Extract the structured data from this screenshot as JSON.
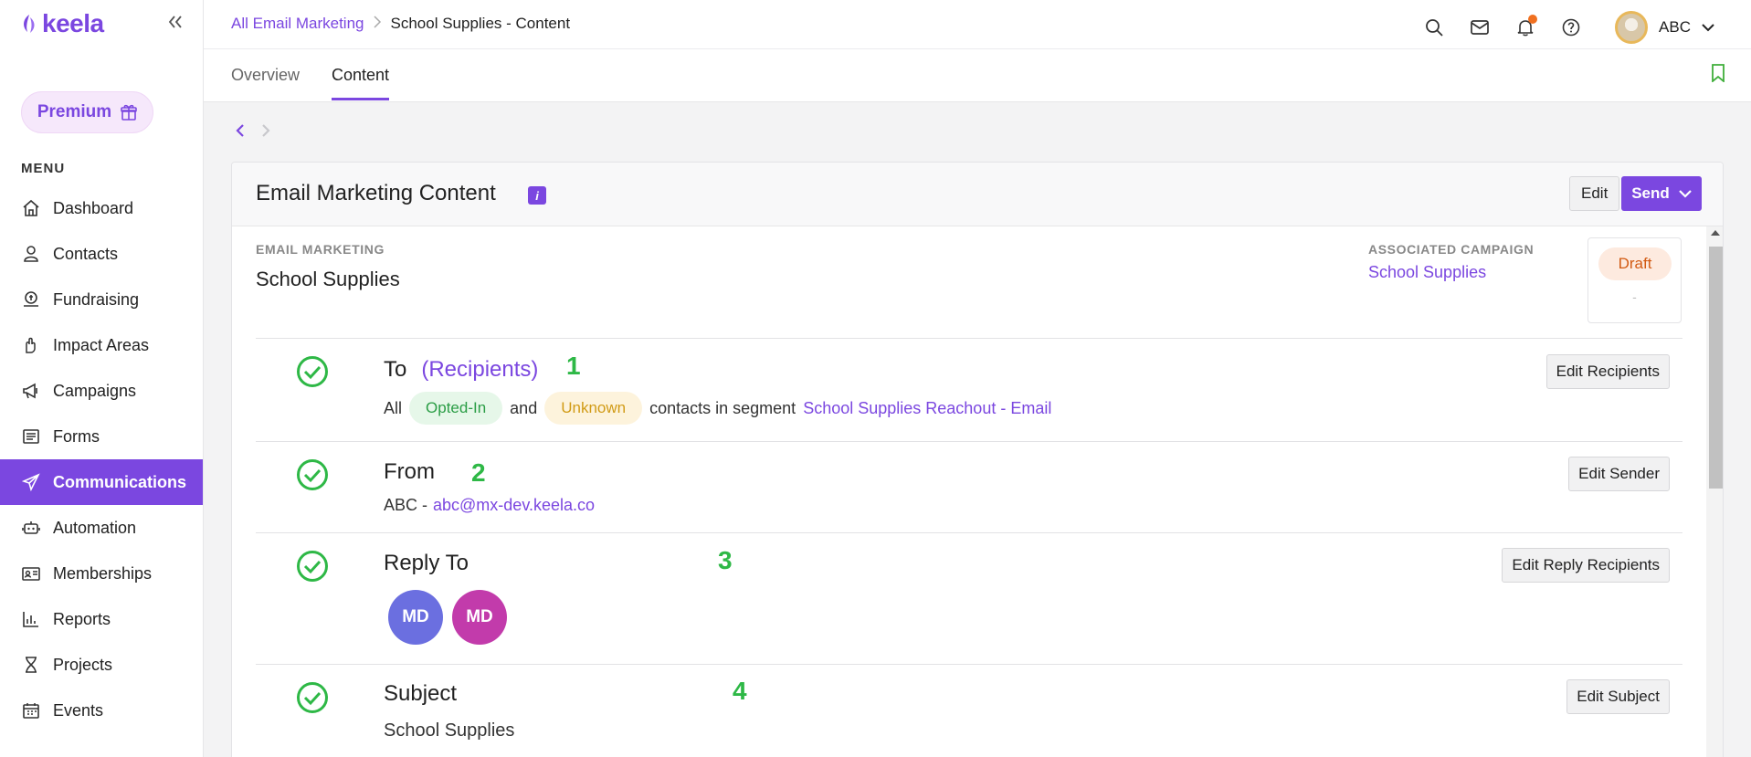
{
  "app": {
    "logo_text": "keela"
  },
  "sidebar": {
    "premium_label": "Premium",
    "menu_heading": "MENU",
    "items": [
      {
        "label": "Dashboard",
        "icon": "home-icon"
      },
      {
        "label": "Contacts",
        "icon": "user-icon"
      },
      {
        "label": "Fundraising",
        "icon": "donation-icon"
      },
      {
        "label": "Impact Areas",
        "icon": "hand-heart-icon"
      },
      {
        "label": "Campaigns",
        "icon": "megaphone-icon"
      },
      {
        "label": "Forms",
        "icon": "form-icon"
      },
      {
        "label": "Communications",
        "icon": "paper-plane-icon",
        "active": true
      },
      {
        "label": "Automation",
        "icon": "robot-icon"
      },
      {
        "label": "Memberships",
        "icon": "id-card-icon"
      },
      {
        "label": "Reports",
        "icon": "bar-chart-icon"
      },
      {
        "label": "Projects",
        "icon": "hourglass-icon"
      },
      {
        "label": "Events",
        "icon": "calendar-icon"
      }
    ]
  },
  "header": {
    "breadcrumb": {
      "parent": "All Email Marketing",
      "current": "School Supplies - Content"
    },
    "user_name": "ABC"
  },
  "tabs": [
    {
      "label": "Overview",
      "active": false
    },
    {
      "label": "Content",
      "active": true
    }
  ],
  "card": {
    "title": "Email Marketing Content",
    "info_badge": "i",
    "edit_label": "Edit",
    "send_label": "Send",
    "email_marketing_label": "EMAIL MARKETING",
    "email_marketing_value": "School Supplies",
    "associated_campaign_label": "ASSOCIATED CAMPAIGN",
    "associated_campaign_value": "School Supplies",
    "status": "Draft",
    "status_sub": "-"
  },
  "sections": {
    "to": {
      "title": "To",
      "title_extra": "(Recipients)",
      "step": "1",
      "button": "Edit Recipients",
      "prefix": "All",
      "pill_opted": "Opted-In",
      "and": "and",
      "pill_unknown": "Unknown",
      "segment_text": "contacts in segment",
      "segment_link": "School Supplies Reachout - Email"
    },
    "from": {
      "title": "From",
      "step": "2",
      "button": "Edit Sender",
      "sender_name": "ABC -",
      "sender_email": "abc@mx-dev.keela.co"
    },
    "reply_to": {
      "title": "Reply To",
      "step": "3",
      "button": "Edit Reply Recipients",
      "avatars": [
        {
          "initials": "MD",
          "color": "#6b6fe0"
        },
        {
          "initials": "MD",
          "color": "#c23bab"
        }
      ]
    },
    "subject": {
      "title": "Subject",
      "step": "4",
      "button": "Edit Subject",
      "value": "School Supplies"
    }
  },
  "colors": {
    "accent": "#7b47e0",
    "success": "#2eb846"
  }
}
